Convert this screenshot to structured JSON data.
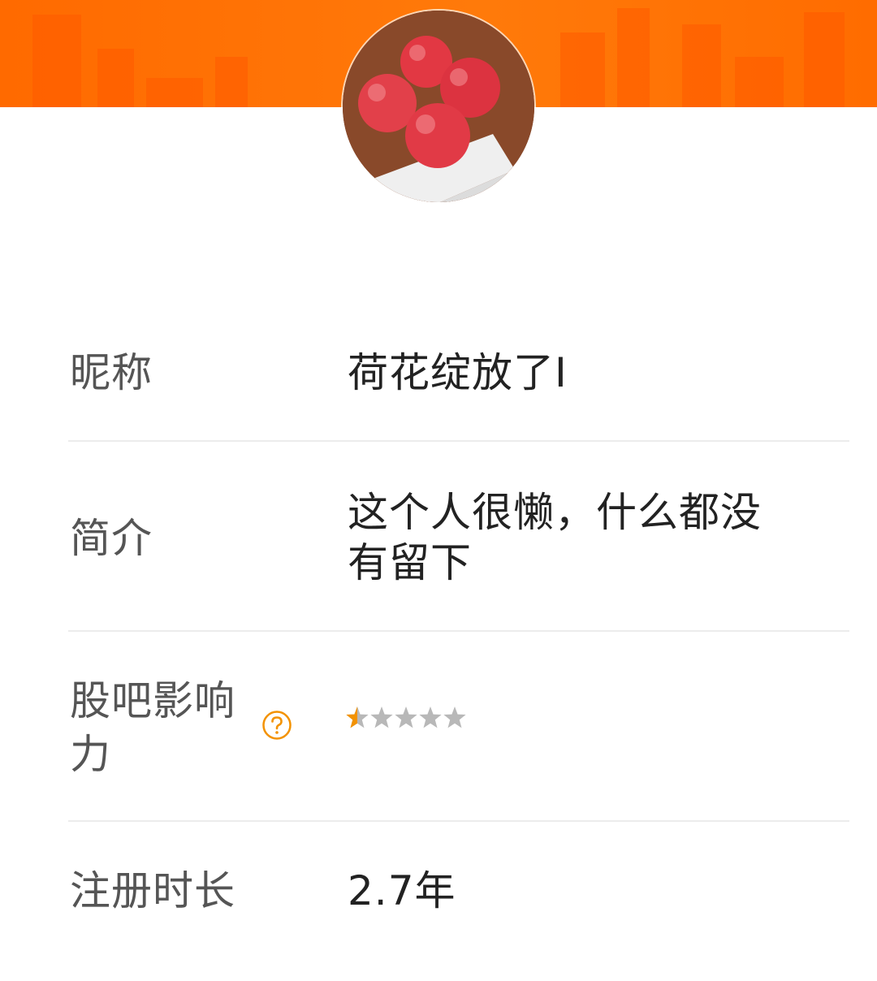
{
  "profile": {
    "avatar": {
      "icon": "apple-photo-avatar"
    },
    "banner": {
      "color": "#ff6a00"
    }
  },
  "fields": {
    "nickname": {
      "label": "昵称",
      "value": "荷花绽放了I"
    },
    "bio": {
      "label": "简介",
      "value_line1": "这个人很懒，什么都没",
      "value_line2": "有留下"
    },
    "influence": {
      "label_line1": "股吧影响",
      "label_line2": "力",
      "help_icon": "question-circle-icon",
      "rating": 0.5,
      "max_rating": 5,
      "star_color": "#f39200",
      "empty_star_color": "#b8b8b8"
    },
    "registration": {
      "label": "注册时长",
      "value": "2.7年"
    }
  }
}
